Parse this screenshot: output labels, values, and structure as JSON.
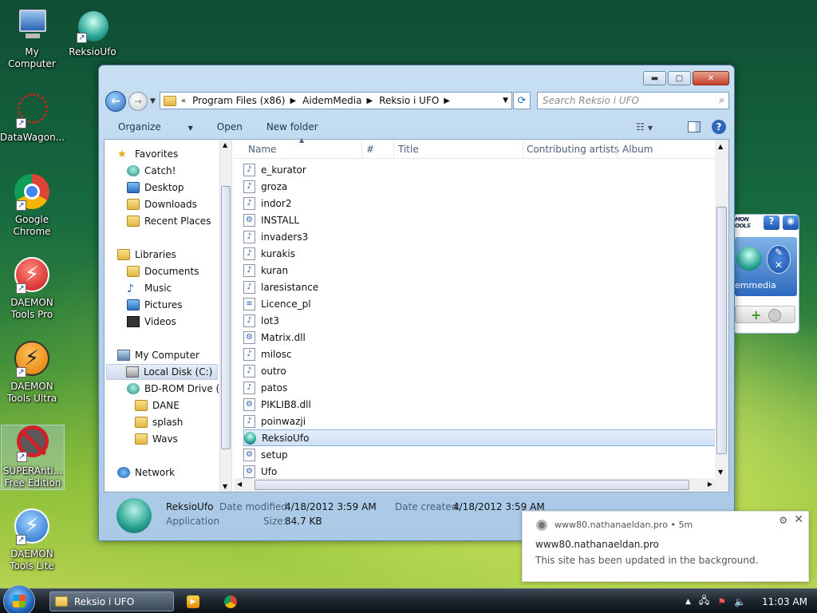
{
  "desktop": {
    "icons": [
      {
        "label": "My Computer",
        "icon": "my-computer-icon"
      },
      {
        "label": "ReksioUfo",
        "icon": "ufo-icon"
      },
      {
        "label": "DataWagon...",
        "icon": "datawagon-icon"
      },
      {
        "label": "Google Chrome",
        "icon": "chrome-icon"
      },
      {
        "label": "DAEMON Tools Pro",
        "icon": "daemon-pro-icon"
      },
      {
        "label": "DAEMON Tools Ultra",
        "icon": "daemon-ultra-icon"
      },
      {
        "label": "SUPERAnti... Free Edition",
        "icon": "superantispyware-icon"
      },
      {
        "label": "DAEMON Tools Lite",
        "icon": "daemon-lite-icon"
      }
    ]
  },
  "window": {
    "breadcrumbs": [
      "Program Files (x86)",
      "AidemMedia",
      "Reksio i UFO"
    ],
    "search_placeholder": "Search Reksio i UFO",
    "toolbar": {
      "organize": "Organize",
      "open": "Open",
      "new_folder": "New folder",
      "help": "?"
    },
    "nav": {
      "favorites": "Favorites",
      "catch": "Catch!",
      "desktop": "Desktop",
      "downloads": "Downloads",
      "recent": "Recent Places",
      "libraries": "Libraries",
      "documents": "Documents",
      "music": "Music",
      "pictures": "Pictures",
      "videos": "Videos",
      "my_computer": "My Computer",
      "local_disk": "Local Disk (C:)",
      "bdrom": "BD-ROM Drive (E",
      "dane": "DANE",
      "splash": "splash",
      "wavs": "Wavs",
      "network": "Network"
    },
    "columns": {
      "name": "Name",
      "num": "#",
      "title": "Title",
      "artists": "Contributing artists",
      "album": "Album"
    },
    "files": [
      {
        "name": "e_kurator",
        "type": "audio"
      },
      {
        "name": "groza",
        "type": "audio"
      },
      {
        "name": "indor2",
        "type": "audio"
      },
      {
        "name": "INSTALL",
        "type": "config"
      },
      {
        "name": "invaders3",
        "type": "audio"
      },
      {
        "name": "kurakis",
        "type": "audio"
      },
      {
        "name": "kuran",
        "type": "audio"
      },
      {
        "name": "laresistance",
        "type": "audio"
      },
      {
        "name": "Licence_pl",
        "type": "text"
      },
      {
        "name": "lot3",
        "type": "audio"
      },
      {
        "name": "Matrix.dll",
        "type": "dll"
      },
      {
        "name": "milosc",
        "type": "audio"
      },
      {
        "name": "outro",
        "type": "audio"
      },
      {
        "name": "patos",
        "type": "audio"
      },
      {
        "name": "PIKLIB8.dll",
        "type": "dll"
      },
      {
        "name": "poinwazji",
        "type": "audio"
      },
      {
        "name": "ReksioUfo",
        "type": "app",
        "selected": true
      },
      {
        "name": "setup",
        "type": "config"
      },
      {
        "name": "Ufo",
        "type": "config"
      }
    ],
    "details": {
      "name": "ReksioUfo",
      "type": "Application",
      "modified_label": "Date modified:",
      "modified_value": "4/18/2012 3:59 AM",
      "created_label": "Date created:",
      "created_value": "4/18/2012 3:59 AM",
      "size_label": "Size:",
      "size_value": "84.7 KB"
    }
  },
  "gadget": {
    "label_top": "MON OOLS",
    "label": "emmedia"
  },
  "notification": {
    "source": "www80.nathanaeldan.pro",
    "age": "5m",
    "title": "www80.nathanaeldan.pro",
    "body": "This site has been updated in the background."
  },
  "taskbar": {
    "active_window": "Reksio i UFO",
    "time": "11:03 AM"
  }
}
